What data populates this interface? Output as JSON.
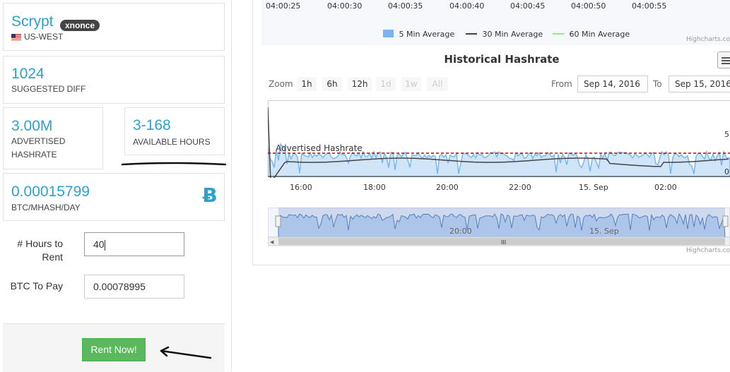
{
  "rig": {
    "algo": "Scrypt",
    "badge": "xnonce",
    "region": "US-WEST"
  },
  "stats": {
    "suggested_diff": {
      "value": "1024",
      "label": "SUGGESTED DIFF"
    },
    "advertised_hashrate": {
      "value": "3.00M",
      "label_line1": "ADVERTISED",
      "label_line2": "HASHRATE"
    },
    "available_hours": {
      "value": "3-168",
      "label": "AVAILABLE HOURS"
    },
    "price": {
      "value": "0.00015799",
      "label": "BTC/MHASH/DAY",
      "icon": "bitcoin-icon"
    }
  },
  "form": {
    "hours_label_line1": "# Hours to",
    "hours_label_line2": "Rent",
    "hours_value": "40",
    "btc_label": "BTC To Pay",
    "btc_value": "0.00078995",
    "rent_button": "Rent Now!"
  },
  "top_chart": {
    "time_labels": [
      "04:00:25",
      "04:00:30",
      "04:00:35",
      "04:00:40",
      "04:00:45",
      "04:00:50",
      "04:00:55"
    ],
    "legend": [
      {
        "name": "5 Min Average",
        "color": "#7cb5ec"
      },
      {
        "name": "30 Min Average",
        "color": "#434348"
      },
      {
        "name": "60 Min Average",
        "color": "#90ed7d"
      }
    ],
    "credit": "Highcharts.com"
  },
  "history_chart": {
    "title": "Historical Hashrate",
    "zoom_label": "Zoom",
    "zoom_buttons": [
      {
        "label": "1h",
        "enabled": true
      },
      {
        "label": "6h",
        "enabled": true
      },
      {
        "label": "12h",
        "enabled": true
      },
      {
        "label": "1d",
        "enabled": false
      },
      {
        "label": "1w",
        "enabled": false
      },
      {
        "label": "All",
        "enabled": false
      }
    ],
    "from_label": "From",
    "from_date": "Sep 14, 2016",
    "to_label": "To",
    "to_date": "Sep 15, 2016",
    "plotline_label": "Advertised Hashrate",
    "y_labels_partial": [
      "5.",
      "0."
    ],
    "x_labels": [
      "16:00",
      "18:00",
      "20:00",
      "22:00",
      "15. Sep",
      "02:00"
    ],
    "navigator_labels": [
      "20:00",
      "15. Sep"
    ],
    "credit": "Highcharts.com",
    "colors": {
      "area": "#7cb5ec",
      "line": "#434348",
      "plotline": "#cc0000"
    }
  }
}
